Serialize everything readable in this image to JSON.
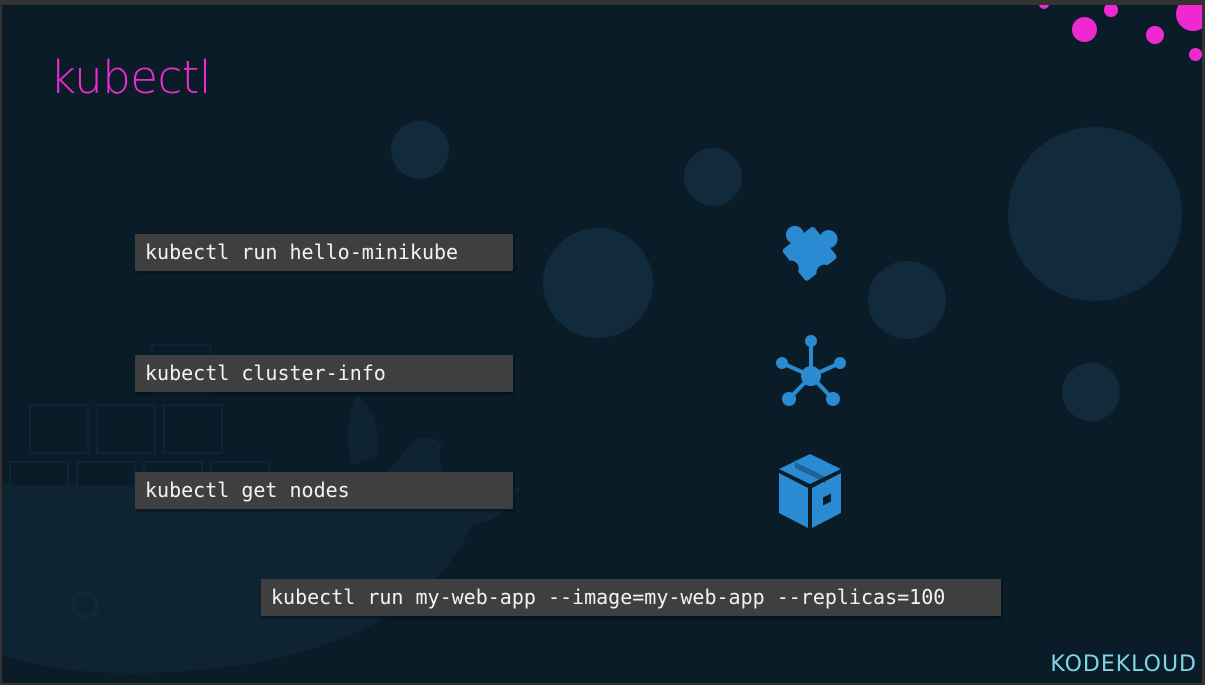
{
  "slide": {
    "title": "kubectl",
    "commands": [
      "kubectl run hello-minikube",
      "kubectl cluster-info",
      "kubectl get nodes",
      "kubectl run my-web-app --image=my-web-app --replicas=100"
    ],
    "icons": [
      "puzzle-piece-icon",
      "network-hub-icon",
      "box-icon"
    ],
    "logo": "KODEKLOUD"
  },
  "colors": {
    "background": "#0a1c28",
    "title": "#ee2ccf",
    "icon": "#2a8bd3",
    "command_box": "#3f3f3f",
    "logo": "#7fd4e8"
  }
}
